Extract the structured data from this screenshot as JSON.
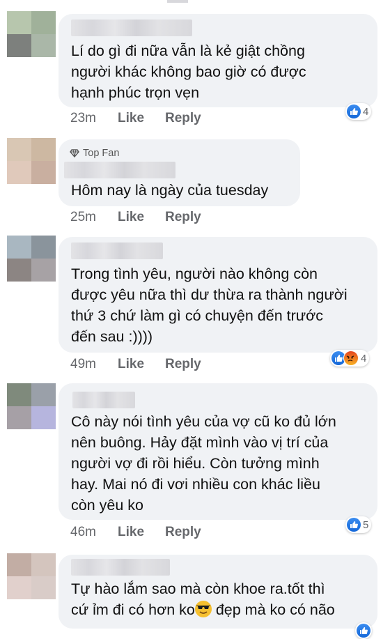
{
  "comments": [
    {
      "top_fan_label": "",
      "text": "Lí do gì đi nữa vẫn là kẻ giật chồng\nngười khác không bao giờ có được\nhạnh phúc trọn vẹn",
      "time": "23m",
      "like_label": "Like",
      "reply_label": "Reply",
      "reaction_count": "4",
      "reactions": [
        "like-icon"
      ]
    },
    {
      "top_fan_label": "Top Fan",
      "text": "Hôm nay là ngày của tuesday",
      "time": "25m",
      "like_label": "Like",
      "reply_label": "Reply",
      "reaction_count": "",
      "reactions": []
    },
    {
      "top_fan_label": "",
      "text": "Trong tình yêu, người nào không còn\nđược yêu nữa thì dư thừa ra thành người\nthứ 3 chứ làm gì có chuyện đến trước\nđến sau :))))",
      "time": "49m",
      "like_label": "Like",
      "reply_label": "Reply",
      "reaction_count": "4",
      "reactions": [
        "like-icon",
        "angry-icon"
      ]
    },
    {
      "top_fan_label": "",
      "text": "Cô này nói tình yêu của vợ cũ ko đủ lớn\nnên buông. Hảy đặt mình vào vị trí của\nngười vợ đi rồi hiểu. Còn tưởng mình\nhay. Mai nó đi vơi nhiều con khác liều\ncòn yêu ko",
      "time": "46m",
      "like_label": "Like",
      "reply_label": "Reply",
      "reaction_count": "5",
      "reactions": [
        "like-icon"
      ]
    },
    {
      "top_fan_label": "",
      "text_line1": "Tự hào lắm sao mà còn khoe ra.tốt thì",
      "text_line2_a": "cứ ỉm đi có hơn ko",
      "text_line2_b": " đẹp mà ko có não",
      "time": "",
      "like_label": "",
      "reply_label": "",
      "reaction_count": "",
      "reactions": [
        "like-icon"
      ]
    }
  ],
  "colors": {
    "bubble": "#f0f2f5",
    "meta_text": "#65676b",
    "like_blue": "#1877f2"
  }
}
